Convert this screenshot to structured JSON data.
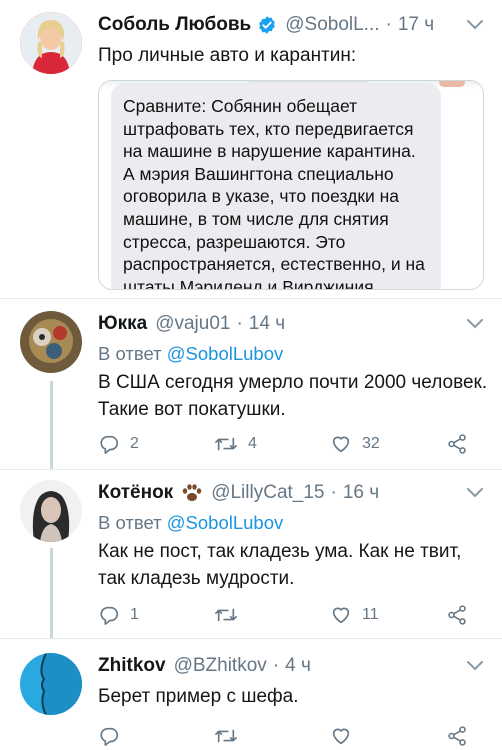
{
  "main_tweet": {
    "name": "Соболь Любовь",
    "handle": "@SobolL...",
    "time": "17 ч",
    "text": "Про личные авто и карантин:",
    "quoted_text": "Сравните: Собянин обещает штрафовать тех, кто передвигается на машине в нарушение карантина. А мэрия Вашингтона специально оговорила в указе, что поездки на машине, в том числе для снятия стресса, разрешаются. Это распространяется, естественно, и на штаты Мэриленд и Вирджиния,"
  },
  "replies": [
    {
      "name": "Юкка",
      "handle": "@vaju01",
      "time": "14 ч",
      "reply_prefix": "В ответ",
      "reply_to": "@SobolLubov",
      "text": "В США сегодня умерло почти 2000 человек. Такие вот покатушки.",
      "replies_count": "2",
      "retweets_count": "4",
      "likes_count": "32"
    },
    {
      "name": "Котёнок",
      "handle": "@LillyCat_15",
      "time": "16 ч",
      "reply_prefix": "В ответ",
      "reply_to": "@SobolLubov",
      "text": "Как не пост, так кладезь ума. Как не твит, так кладезь мудрости.",
      "replies_count": "1",
      "retweets_count": "",
      "likes_count": "11"
    },
    {
      "name": "Zhitkov",
      "handle": "@BZhitkov",
      "time": "4 ч",
      "text": "Берет пример с шефа.",
      "replies_count": "",
      "retweets_count": "",
      "likes_count": ""
    }
  ],
  "dot": "·",
  "colors": {
    "accent": "#1b95e0",
    "verified": "#1da1f2",
    "secondary_text": "#657786",
    "divider": "#e6ecf0"
  }
}
